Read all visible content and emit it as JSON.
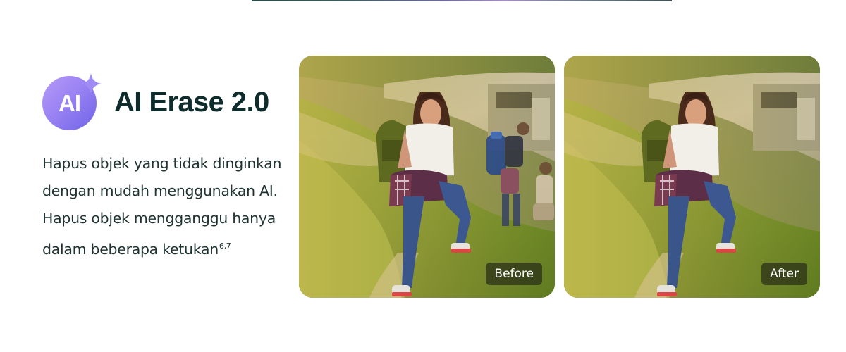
{
  "feature": {
    "badge_text": "AI",
    "title": "AI Erase 2.0",
    "description_lines": [
      "Hapus objek yang tidak dinginkan",
      "dengan mudah menggunakan AI.",
      "Hapus objek mengganggu hanya",
      "dalam beberapa ketukan"
    ],
    "footnote": "6,7"
  },
  "comparison": {
    "before_label": "Before",
    "after_label": "After"
  },
  "icons": {
    "badge": "ai-badge-icon",
    "sparkle": "sparkle-icon"
  },
  "colors": {
    "title": "#0d2c2b",
    "body_text": "#1f3332",
    "badge_gradient_start": "#b69af7",
    "badge_gradient_end": "#6f63e7",
    "tag_background": "#2c2c16"
  }
}
